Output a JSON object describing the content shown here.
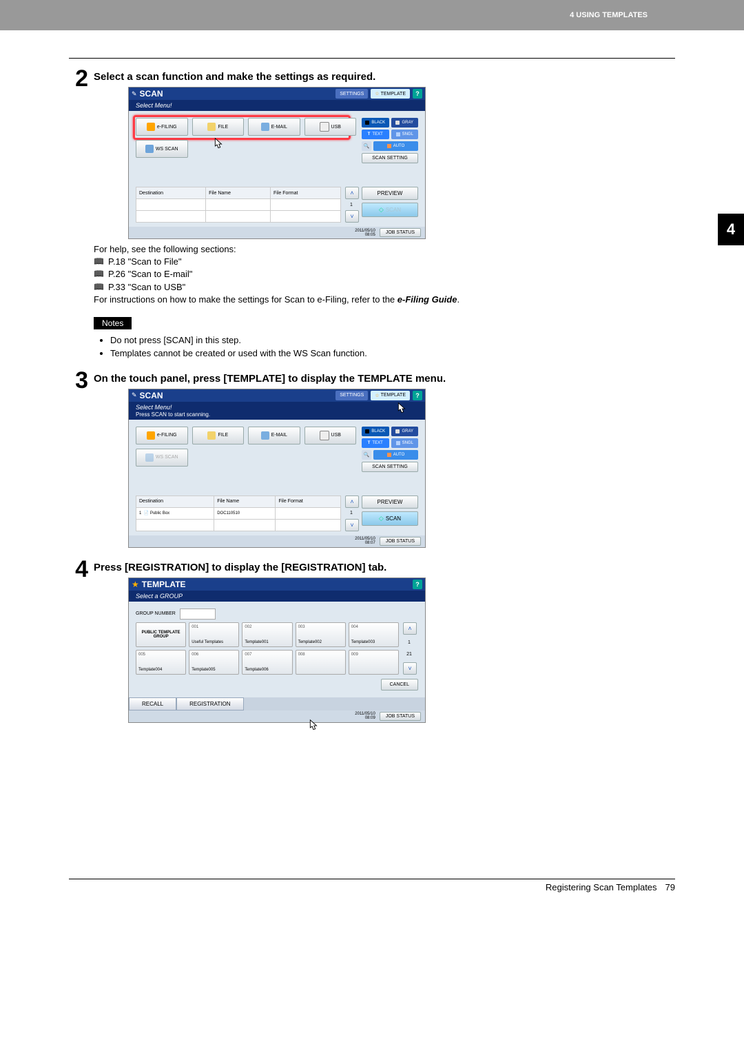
{
  "header": {
    "chapter_label": "4 USING TEMPLATES"
  },
  "chapter_tab": "4",
  "step2": {
    "num": "2",
    "title": "Select a scan function and make the settings as required.",
    "help_intro": "For help, see the following sections:",
    "refs": [
      "P.18 \"Scan to File\"",
      "P.26 \"Scan to E-mail\"",
      "P.33 \"Scan to USB\""
    ],
    "inst_prefix": "For instructions on how to make the settings for Scan to e-Filing, refer to the ",
    "inst_italic": "e-Filing Guide",
    "inst_suffix": ".",
    "notes_label": "Notes",
    "notes": [
      "Do not press [SCAN] in this step.",
      "Templates cannot be created or used with the WS Scan function."
    ]
  },
  "step3": {
    "num": "3",
    "title": "On the touch panel, press [TEMPLATE] to display the TEMPLATE menu."
  },
  "step4": {
    "num": "4",
    "title": "Press [REGISTRATION] to display the [REGISTRATION] tab."
  },
  "touchscreen_common": {
    "title": "SCAN",
    "settings_btn": "SETTINGS",
    "template_btn": "TEMPLATE",
    "help": "?",
    "select_menu": "Select Menu!",
    "press_scan": "Press SCAN to start scanning.",
    "funcs": {
      "efiling": "e-FILING",
      "file": "FILE",
      "email": "E-MAIL",
      "usb": "USB",
      "wsscan": "WS SCAN"
    },
    "side": {
      "black": "BLACK",
      "gray": "GRAY",
      "text": "TEXT",
      "snap": "SNGL",
      "auto": "AUTO",
      "scan_setting": "SCAN SETTING"
    },
    "table": {
      "destination": "Destination",
      "filename": "File Name",
      "fileformat": "File Format",
      "row_dest": "Public Box",
      "row_file": "DOC110510"
    },
    "preview": "PREVIEW",
    "scan_btn": "SCAN",
    "jobstatus": "JOB STATUS",
    "page_indicator": "1",
    "date1": "2011/05/10",
    "time1": "08:05",
    "time2": "08:07"
  },
  "template_screen": {
    "title": "TEMPLATE",
    "sub": "Select a GROUP",
    "group_number": "GROUP NUMBER",
    "cells": [
      {
        "num": "",
        "name": "PUBLIC TEMPLATE GROUP",
        "public": true
      },
      {
        "num": "001",
        "name": "Useful Templates"
      },
      {
        "num": "002",
        "name": "Template001"
      },
      {
        "num": "003",
        "name": "Template002"
      },
      {
        "num": "004",
        "name": "Template003"
      },
      {
        "num": "005",
        "name": "Template004"
      },
      {
        "num": "006",
        "name": "Template005"
      },
      {
        "num": "007",
        "name": "Template006"
      },
      {
        "num": "008",
        "name": "",
        "empty": true
      },
      {
        "num": "009",
        "name": "",
        "empty": true
      }
    ],
    "cancel": "CANCEL",
    "recall_tab": "RECALL",
    "registration_tab": "REGISTRATION",
    "pages": {
      "cur": "1",
      "total": "21"
    },
    "date": "2011/05/10",
    "time": "08:09"
  },
  "footer": {
    "title": "Registering Scan Templates",
    "page": "79"
  }
}
